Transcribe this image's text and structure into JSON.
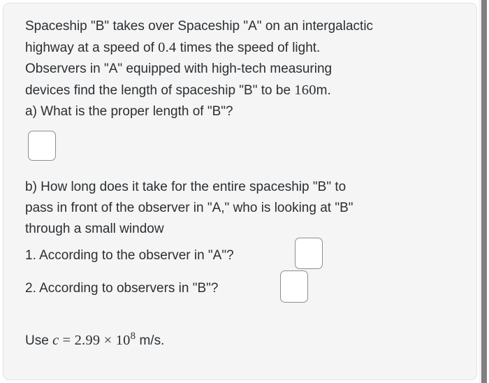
{
  "problem": {
    "statement_lines": [
      "Spaceship \"B\" takes over Spaceship \"A\" on an intergalactic",
      "highway at a speed of ",
      " times the speed of light.",
      "Observers in \"A\" equipped with high-tech measuring",
      "devices find the length of spaceship \"B\" to be ",
      "m."
    ],
    "speed_value": "0.4",
    "measured_length": "160",
    "part_a": {
      "prompt": "a) What is the proper length of \"B\"?",
      "answer_value": "",
      "answer_placeholder": ""
    },
    "part_b": {
      "prompt_lines": [
        "b) How long does it take for the entire spaceship \"B\" to",
        "pass in front of the observer in \"A,\" who is looking at \"B\"",
        "through a small window"
      ],
      "subquestions": [
        {
          "label": "1. According to the observer in \"A\"?",
          "answer_value": "",
          "answer_placeholder": ""
        },
        {
          "label": "2. According to observers in \"B\"?",
          "answer_value": "",
          "answer_placeholder": ""
        }
      ]
    },
    "constant_note": {
      "prefix": "Use ",
      "symbol": "c",
      "equals": " = ",
      "mantissa": "2.99",
      "times": " × ",
      "base": "10",
      "exponent": "8",
      "units": " m/s."
    }
  },
  "colors": {
    "card_background": "#f5f5f5",
    "card_border": "#e3e3e3",
    "text": "#2a2f33",
    "input_border": "#8a8f94",
    "input_background": "#ffffff",
    "scrollbar_thumb": "#808080",
    "scrollbar_track": "#f1f1f1"
  }
}
